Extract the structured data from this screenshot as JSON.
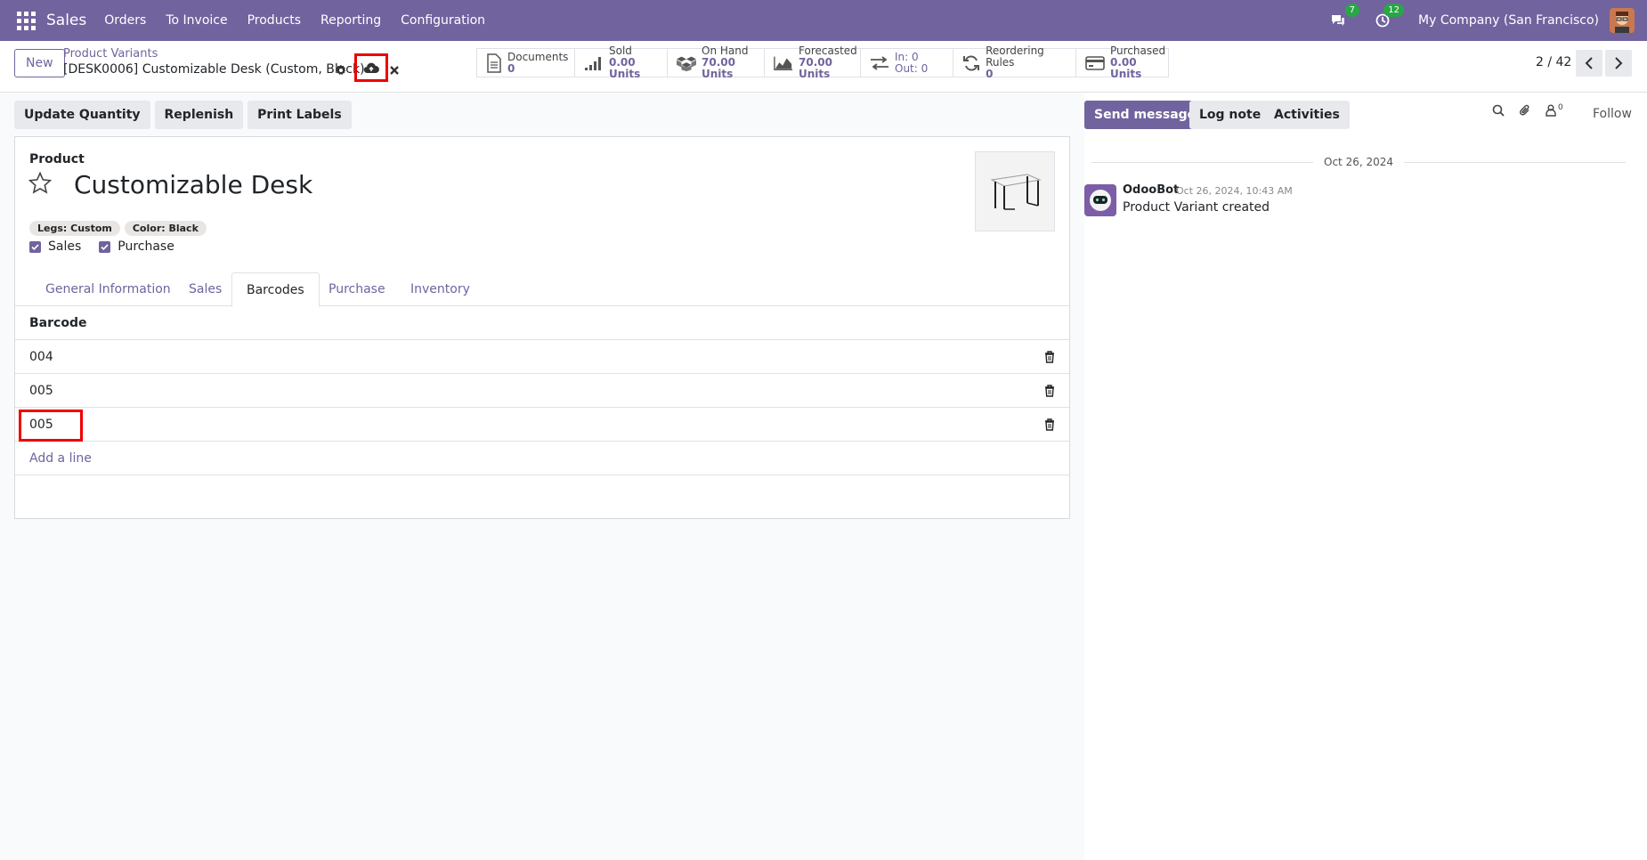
{
  "navbar": {
    "brand": "Sales",
    "menu": [
      "Orders",
      "To Invoice",
      "Products",
      "Reporting",
      "Configuration"
    ],
    "messages_badge": "7",
    "activities_badge": "12",
    "company": "My Company (San Francisco)"
  },
  "control": {
    "new_label": "New",
    "breadcrumb_parent": "Product Variants",
    "breadcrumb_current": "[DESK0006] Customizable Desk (Custom, Black)",
    "pager": "2 / 42",
    "smart_buttons": {
      "documents": {
        "label": "Documents",
        "value": "0"
      },
      "sold": {
        "label": "Sold",
        "value": "0.00 Units"
      },
      "on_hand": {
        "label": "On Hand",
        "value": "70.00 Units"
      },
      "forecasted": {
        "label": "Forecasted",
        "value": "70.00 Units"
      },
      "in_out": {
        "in": "In: 0",
        "out": "Out: 0"
      },
      "reordering": {
        "label": "Reordering Rules",
        "value": "0"
      },
      "purchased": {
        "label": "Purchased",
        "value": "0.00 Units"
      }
    }
  },
  "status_buttons": [
    "Update Quantity",
    "Replenish",
    "Print Labels"
  ],
  "form": {
    "product_label": "Product",
    "product_name": "Customizable Desk",
    "tags": [
      "Legs: Custom",
      "Color: Black"
    ],
    "checkboxes": [
      "Sales",
      "Purchase"
    ],
    "tabs": [
      "General Information",
      "Sales",
      "Barcodes",
      "Purchase",
      "Inventory"
    ],
    "barcode_header": "Barcode",
    "barcodes": [
      "004",
      "005",
      "005"
    ],
    "add_line": "Add a line"
  },
  "chatter": {
    "send_message": "Send message",
    "log_note": "Log note",
    "activities": "Activities",
    "followers_count": "0",
    "follow": "Follow",
    "date_separator": "Oct 26, 2024",
    "message": {
      "author": "OdooBot",
      "date": "Oct 26, 2024, 10:43 AM",
      "body": "Product Variant created"
    }
  },
  "colors": {
    "brand": "#71639e",
    "highlight": "#ee0000"
  }
}
